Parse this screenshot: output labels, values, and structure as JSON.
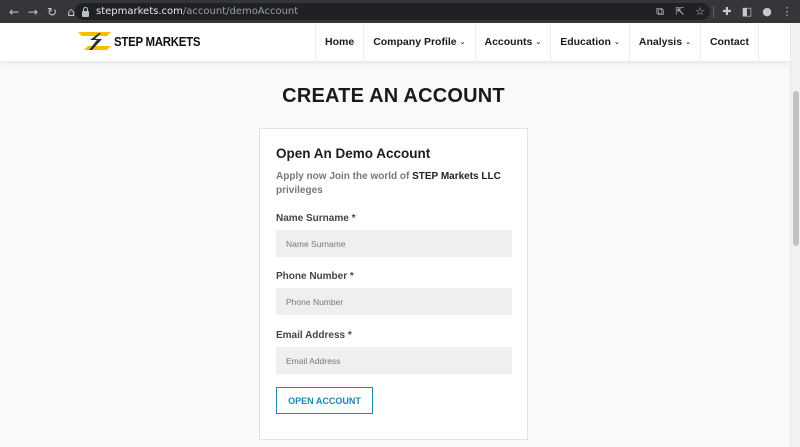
{
  "browser": {
    "url_host": "stepmarkets.com",
    "url_path": "/account/demoAccount"
  },
  "site": {
    "brand": "STEP MARKETS",
    "nav": [
      {
        "label": "Home"
      },
      {
        "label": "Company Profile"
      },
      {
        "label": "Accounts"
      },
      {
        "label": "Education"
      },
      {
        "label": "Analysis"
      },
      {
        "label": "Contact"
      }
    ]
  },
  "page": {
    "title": "CREATE AN ACCOUNT"
  },
  "form": {
    "title": "Open An Demo Account",
    "subtitle_prefix": "Apply now Join the world of ",
    "subtitle_brand": "STEP Markets LLC",
    "subtitle_suffix": " privileges",
    "name_label": "Name Surname *",
    "name_placeholder": "Name Surname",
    "phone_label": "Phone Number *",
    "phone_placeholder": "Phone Number",
    "email_label": "Email Address *",
    "email_placeholder": "Email Address",
    "submit_label": "OPEN ACCOUNT"
  },
  "colors": {
    "accent": "#1a86b5",
    "logo_yellow": "#f2c200",
    "chrome_bg": "#35363a"
  },
  "icons": [
    "back-arrow-icon",
    "forward-arrow-icon",
    "reload-icon",
    "home-icon",
    "lock-icon",
    "translate-icon",
    "share-icon",
    "bookmark-star-icon",
    "extensions-icon",
    "sidebar-icon",
    "profile-icon",
    "menu-dots-icon",
    "chevron-down-icon"
  ]
}
